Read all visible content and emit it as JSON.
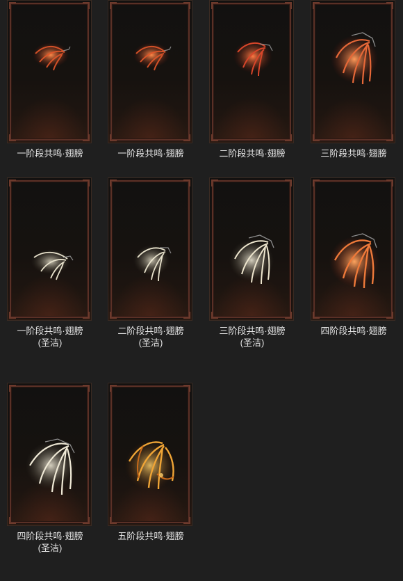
{
  "gallery": {
    "items": [
      {
        "title": "一阶段共鸣·翅膀",
        "subtitle": "",
        "variant": "red",
        "accent": "#e2572a"
      },
      {
        "title": "一阶段共鸣·翅膀",
        "subtitle": "",
        "variant": "red",
        "accent": "#e2572a"
      },
      {
        "title": "二阶段共鸣·翅膀",
        "subtitle": "",
        "variant": "red",
        "accent": "#d8462a"
      },
      {
        "title": "三阶段共鸣·翅膀",
        "subtitle": "",
        "variant": "red-large",
        "accent": "#e66838"
      },
      {
        "title": "一阶段共鸣·翅膀",
        "subtitle": "(圣洁)",
        "variant": "white",
        "accent": "#e8e2cc"
      },
      {
        "title": "二阶段共鸣·翅膀",
        "subtitle": "(圣洁)",
        "variant": "white",
        "accent": "#e8e2cc"
      },
      {
        "title": "三阶段共鸣·翅膀",
        "subtitle": "(圣洁)",
        "variant": "white-large",
        "accent": "#efe7cf"
      },
      {
        "title": "四阶段共鸣·翅膀",
        "subtitle": "",
        "variant": "red-large",
        "accent": "#ef7a3a"
      },
      {
        "title": "四阶段共鸣·翅膀",
        "subtitle": "(圣洁)",
        "variant": "white-large",
        "accent": "#efe9d6"
      },
      {
        "title": "五阶段共鸣·翅膀",
        "subtitle": "",
        "variant": "gold",
        "accent": "#f0a536"
      }
    ]
  }
}
